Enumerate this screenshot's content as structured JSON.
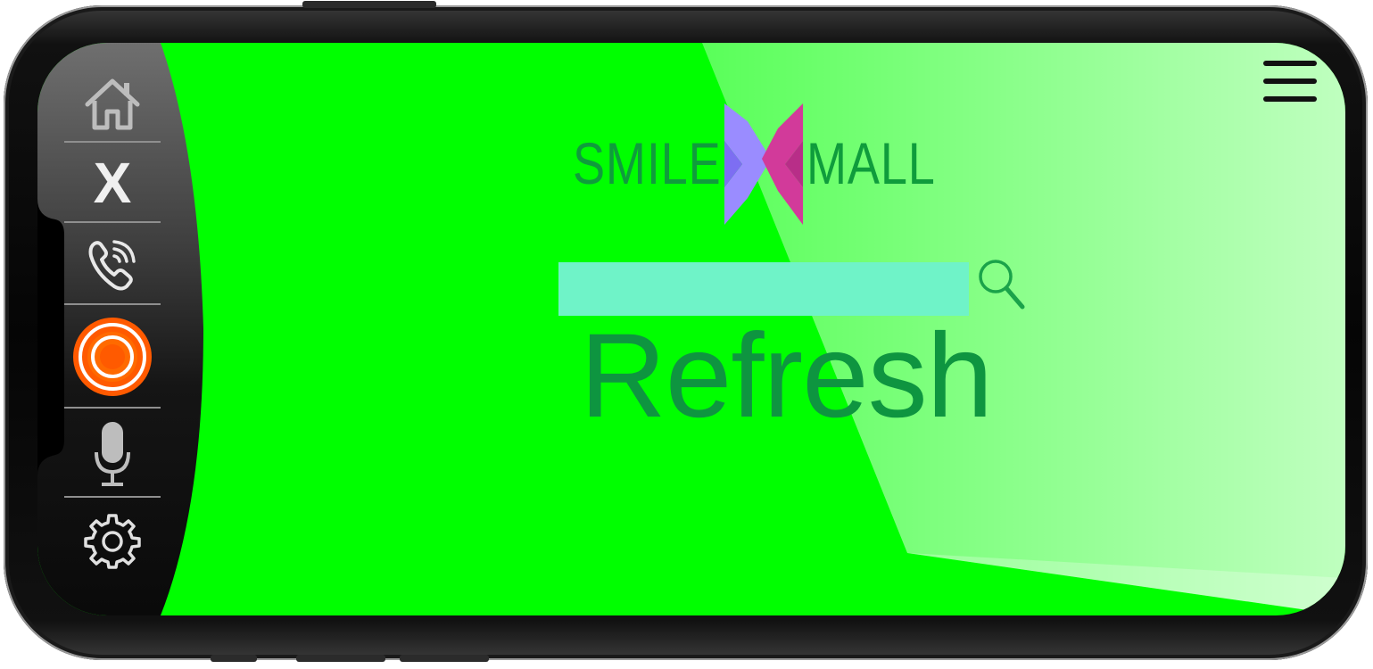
{
  "sidebar": {
    "items": [
      {
        "name": "home",
        "icon": "home-icon"
      },
      {
        "name": "close",
        "label": "X",
        "icon": "close-icon"
      },
      {
        "name": "call",
        "icon": "phone-call-icon"
      },
      {
        "name": "record",
        "icon": "record-icon",
        "color": "#ff6a00"
      },
      {
        "name": "microphone",
        "icon": "microphone-icon"
      },
      {
        "name": "settings",
        "icon": "gear-icon"
      }
    ]
  },
  "header": {
    "menu_icon": "hamburger-menu-icon"
  },
  "logo": {
    "left_text": "SMILE",
    "right_text": "MALL",
    "colors": {
      "text": "#0f9c3c",
      "violet": "#9a8cff",
      "magenta": "#d23a9a"
    }
  },
  "search": {
    "value": "",
    "placeholder": "",
    "icon": "search-icon"
  },
  "main": {
    "refresh_label": "Refresh"
  },
  "theme": {
    "screen_bg": "#00ff00",
    "refresh_color": "#0e9540",
    "search_bg": "#6ff3c8"
  }
}
